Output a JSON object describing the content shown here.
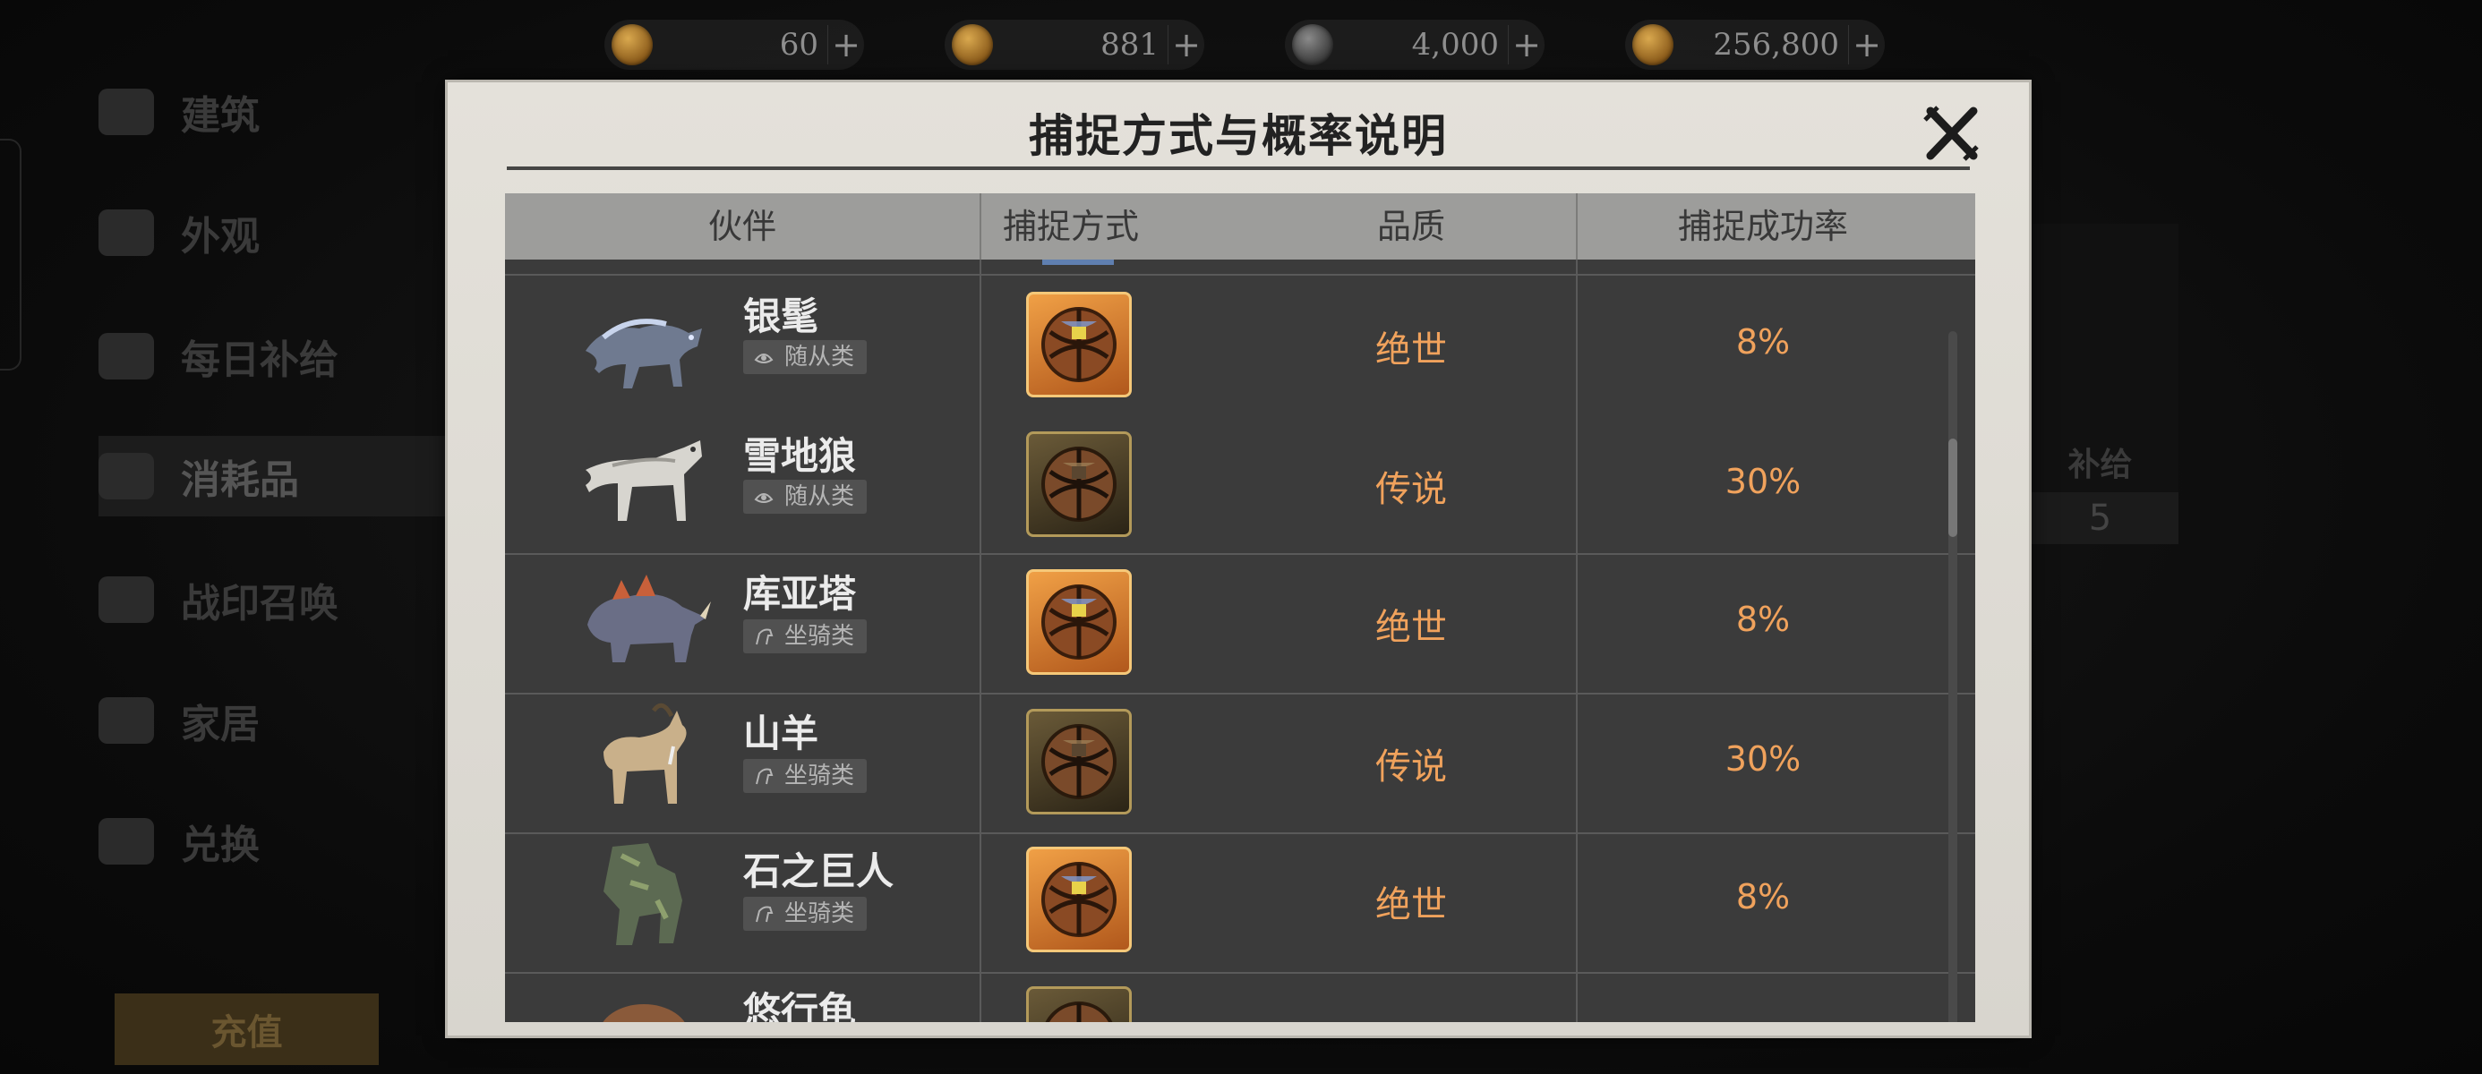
{
  "currencies": [
    {
      "value": "60",
      "plus": "+"
    },
    {
      "value": "881",
      "plus": "+"
    },
    {
      "value": "4,000",
      "plus": "+"
    },
    {
      "value": "256,800",
      "plus": "+"
    }
  ],
  "sidebar": {
    "items": [
      {
        "label": "建筑"
      },
      {
        "label": "外观"
      },
      {
        "label": "每日补给"
      },
      {
        "label": "消耗品"
      },
      {
        "label": "战印召唤"
      },
      {
        "label": "家居"
      },
      {
        "label": "兑换"
      }
    ],
    "recharge_label": "充值"
  },
  "right_card": {
    "title": "补给",
    "price": "5"
  },
  "modal": {
    "title": "捕捉方式与概率说明",
    "headers": {
      "partner": "伙伴",
      "method": "捕捉方式",
      "quality": "品质",
      "rate": "捕捉成功率"
    },
    "rows": [
      {
        "name": "银髦",
        "tag": "随从类",
        "tag_icon": "follower-icon",
        "ball": "orange",
        "quality": "绝世",
        "rate": "8%"
      },
      {
        "name": "雪地狼",
        "tag": "随从类",
        "tag_icon": "follower-icon",
        "ball": "gold",
        "quality": "传说",
        "rate": "30%"
      },
      {
        "name": "库亚塔",
        "tag": "坐骑类",
        "tag_icon": "mount-icon",
        "ball": "orange",
        "quality": "绝世",
        "rate": "8%"
      },
      {
        "name": "山羊",
        "tag": "坐骑类",
        "tag_icon": "mount-icon",
        "ball": "gold",
        "quality": "传说",
        "rate": "30%"
      },
      {
        "name": "石之巨人",
        "tag": "坐骑类",
        "tag_icon": "mount-icon",
        "ball": "orange",
        "quality": "绝世",
        "rate": "8%"
      },
      {
        "name": "悠行龟",
        "tag": "",
        "tag_icon": "",
        "ball": "gold",
        "quality": "",
        "rate": ""
      }
    ]
  },
  "colors": {
    "accent": "#f0a25c",
    "table_bg": "#3b3b3b",
    "header_bg": "#9d9d9b"
  }
}
